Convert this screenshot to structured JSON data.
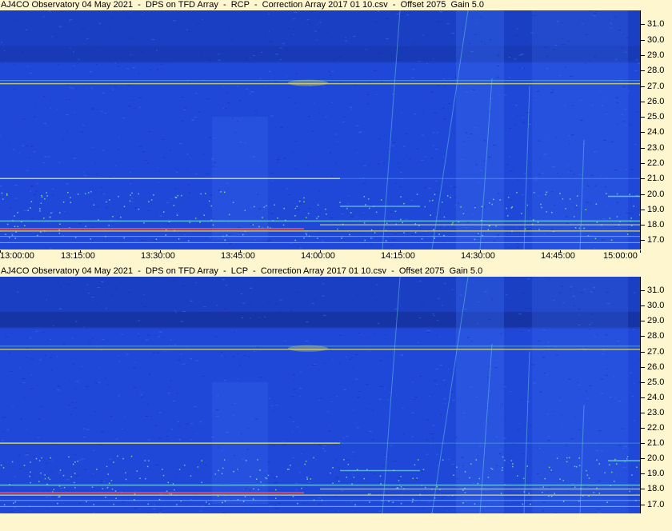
{
  "chart_data": [
    {
      "type": "heatmap",
      "title": "AJ4CO Observatory 04 May 2021  -  DPS on TFD Array  -  RCP  -  Correction Array 2017 01 10.csv  -  Offset 2075  Gain 5.0",
      "x_tick_labels": [
        "13:00:00",
        "13:15:00",
        "13:30:00",
        "13:45:00",
        "14:00:00",
        "14:15:00",
        "14:30:00",
        "14:45:00",
        "15:00:00"
      ],
      "y_tick_labels": [
        "31.0",
        "30.0",
        "29.0",
        "28.0",
        "27.0",
        "26.0",
        "25.0",
        "24.0",
        "23.0",
        "22.0",
        "21.0",
        "20.0",
        "19.0",
        "18.0",
        "17.0"
      ],
      "x_range": [
        "13:00:00",
        "15:00:00"
      ],
      "y_range": [
        16.4,
        31.9
      ],
      "grid": false
    },
    {
      "type": "heatmap",
      "title": "AJ4CO Observatory 04 May 2021  -  DPS on TFD Array  -  LCP  -  Correction Array 2017 01 10.csv  -  Offset 2075  Gain 5.0",
      "y_tick_labels": [
        "31.0",
        "30.0",
        "29.0",
        "28.0",
        "27.0",
        "26.0",
        "25.0",
        "24.0",
        "23.0",
        "22.0",
        "21.0",
        "20.0",
        "19.0",
        "18.0",
        "17.0"
      ],
      "y_range": [
        16.4,
        31.9
      ],
      "grid": false
    }
  ],
  "colors": {
    "background": "#1f48d8",
    "dark_band": "#1838b0",
    "bright_line": "#e0e060",
    "hot_line": "#e05070",
    "cyan_line": "#70d8e0",
    "panel_bg": "#fdf6cf"
  }
}
